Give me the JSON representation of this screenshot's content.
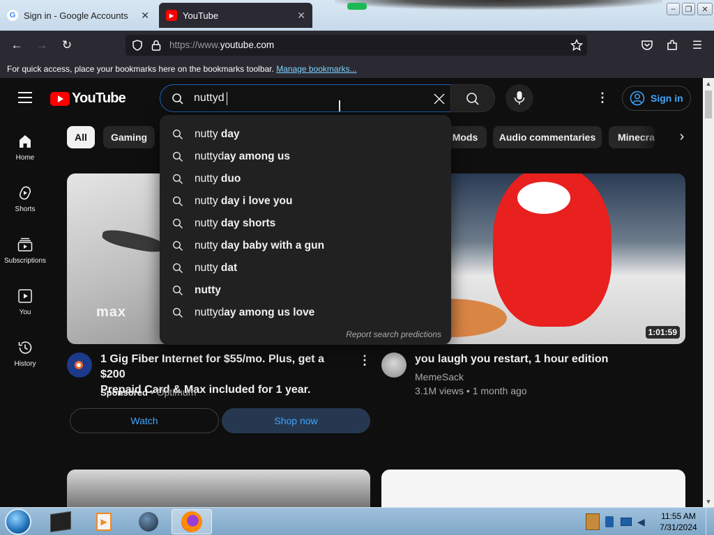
{
  "browser": {
    "tabs": [
      {
        "label": "Sign in - Google Accounts",
        "active": false
      },
      {
        "label": "YouTube",
        "active": true
      }
    ],
    "url_prefix": "https://www.",
    "url_domain": "youtube.com",
    "bookmark_hint": "For quick access, place your bookmarks here on the bookmarks toolbar.",
    "bookmark_link": "Manage bookmarks..."
  },
  "youtube": {
    "logo_text": "YouTube",
    "search_value": "nuttyd",
    "sign_in": "Sign in",
    "sidebar": [
      {
        "label": "Home",
        "icon": "home-icon"
      },
      {
        "label": "Shorts",
        "icon": "shorts-icon"
      },
      {
        "label": "Subscriptions",
        "icon": "subscriptions-icon"
      },
      {
        "label": "You",
        "icon": "you-icon"
      },
      {
        "label": "History",
        "icon": "history-icon"
      }
    ],
    "chips": [
      "All",
      "Gaming",
      "Mods",
      "Audio commentaries",
      "Minecra"
    ],
    "suggestions": [
      {
        "typed": "nutty",
        "rest": " day"
      },
      {
        "typed": "nuttyd",
        "rest": "ay among us"
      },
      {
        "typed": "nutty",
        "rest": " duo"
      },
      {
        "typed": "nutty",
        "rest": " day i love you"
      },
      {
        "typed": "nutty",
        "rest": " day shorts"
      },
      {
        "typed": "nutty",
        "rest": " day baby with a gun"
      },
      {
        "typed": "nutty",
        "rest": " dat"
      },
      {
        "typed": "nutty",
        "rest": ""
      },
      {
        "typed": "nuttyd",
        "rest": "ay among us love"
      }
    ],
    "report_predictions": "Report search predictions",
    "ad": {
      "title_line1": "1 Gig Fiber Internet for $55/mo. Plus, get a $200",
      "title_line2": "Prepaid Card & Max included for 1 year.",
      "sponsored": "Sponsored",
      "advertiser": "Optimum",
      "watch": "Watch",
      "shop_now": "Shop now",
      "thumb_brand": "max"
    },
    "video": {
      "title": "you laugh you restart, 1 hour edition",
      "channel": "MemeSack",
      "views": "3.1M views",
      "age": "1 month ago",
      "duration": "1:01:59"
    }
  },
  "taskbar": {
    "time": "11:55 AM",
    "date": "7/31/2024"
  },
  "colors": {
    "yt_background": "#0f0f0f",
    "yt_red": "#ff0000",
    "link_blue": "#3ea6ff",
    "browser_dark": "#2b2a33"
  }
}
